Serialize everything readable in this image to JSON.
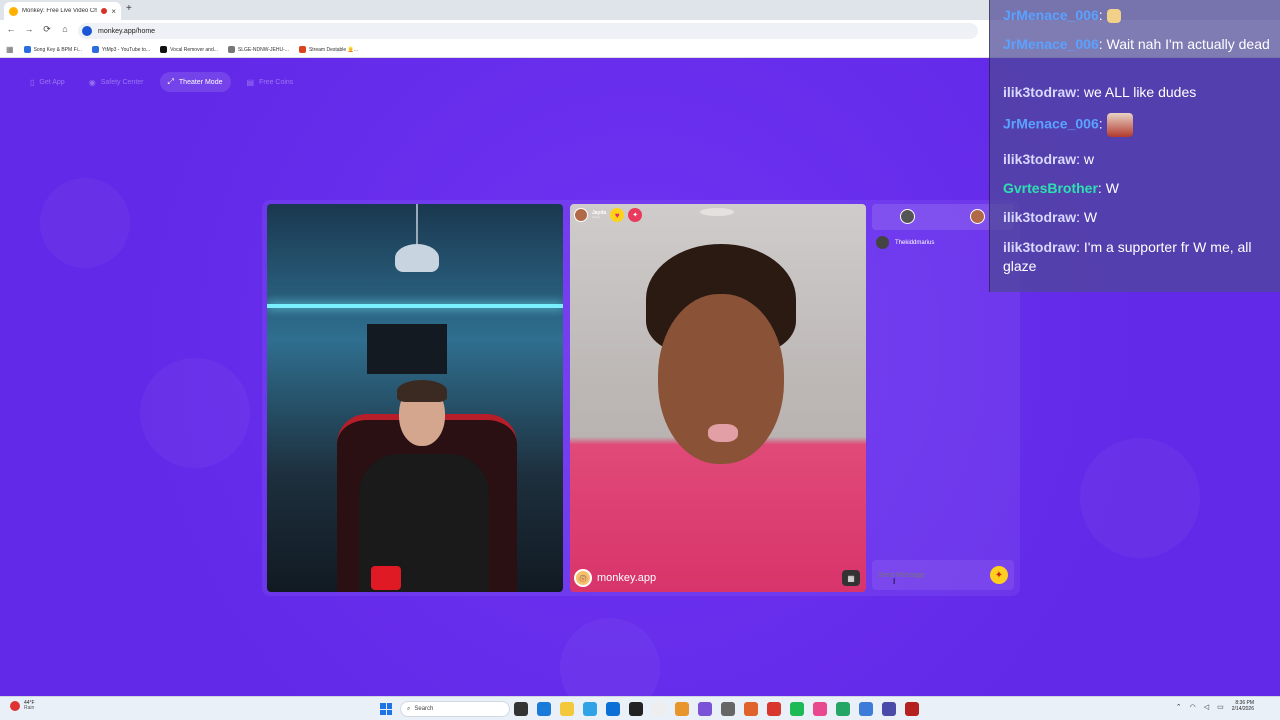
{
  "browser": {
    "tab_title": "Monkey: Free Live Video Ch",
    "tab_close": "×",
    "new_tab": "+",
    "back": "←",
    "forward": "→",
    "reload": "⟳",
    "home": "⌂",
    "url": "monkey.app/home",
    "bookmarks": [
      {
        "label": "Song Key & BPM Fi...",
        "color": "#2b6de0"
      },
      {
        "label": "YtMp3 - YouTube to...",
        "color": "#2b6de0"
      },
      {
        "label": "Vocal Remover and...",
        "color": "#111111"
      },
      {
        "label": "SLGE-NDNW-JEHU-...",
        "color": "#777777"
      },
      {
        "label": "Stream Destable 👱...",
        "color": "#d9431e"
      }
    ]
  },
  "nav": {
    "items": [
      {
        "label": "Get App",
        "icon": "▯"
      },
      {
        "label": "Safety Center",
        "icon": "◉"
      },
      {
        "label": "Theater Mode",
        "icon": "⤢"
      },
      {
        "label": "Free Coins",
        "icon": "▤"
      }
    ]
  },
  "video_right": {
    "name": "Jayda",
    "sub": "Texas",
    "heart": "♥",
    "pin": "✦",
    "brand": "monkey.app",
    "brand_logo": "🐵",
    "game": "▦"
  },
  "side_chat": {
    "user": "Thekiddmarius",
    "placeholder": "Send Message",
    "gift": "✦",
    "cursor": "I"
  },
  "overlay": {
    "messages": [
      {
        "user": "JrMenace_006",
        "user_color": "#5aa2ff",
        "text": "",
        "emote": "small"
      },
      {
        "user": "JrMenace_006",
        "user_color": "#5aa2ff",
        "text": " Wait nah I'm actually dead",
        "emote": ""
      },
      {
        "user": "ilik3todraw",
        "user_color": "#d8d8ff",
        "text": " we ALL like dudes",
        "emote": ""
      },
      {
        "user": "JrMenace_006",
        "user_color": "#5aa2ff",
        "text": "",
        "emote": "big"
      },
      {
        "user": "ilik3todraw",
        "user_color": "#d8d8ff",
        "text": " w",
        "emote": ""
      },
      {
        "user": "GvrtesBrother",
        "user_color": "#2ee0b0",
        "text": " W",
        "emote": ""
      },
      {
        "user": "ilik3todraw",
        "user_color": "#d8d8ff",
        "text": " W",
        "emote": ""
      },
      {
        "user": "ilik3todraw",
        "user_color": "#d8d8ff",
        "text": " I'm a supporter fr W me, all glaze",
        "emote": ""
      }
    ]
  },
  "taskbar": {
    "temp": "44°F",
    "condition": "Rain",
    "search": "Search",
    "time": "8:36 PM",
    "date": "2/14/2026",
    "app_colors": [
      "#333333",
      "#1a7ad9",
      "#f3c93b",
      "#2fa3e6",
      "#0b6fd6",
      "#222222",
      "#eeeeee",
      "#e8962b",
      "#7a53d6",
      "#666666",
      "#e0632b",
      "#d9362d",
      "#1db954",
      "#e9488e",
      "#22a565",
      "#3d7bd9",
      "#4a4aa8",
      "#b52020"
    ]
  }
}
